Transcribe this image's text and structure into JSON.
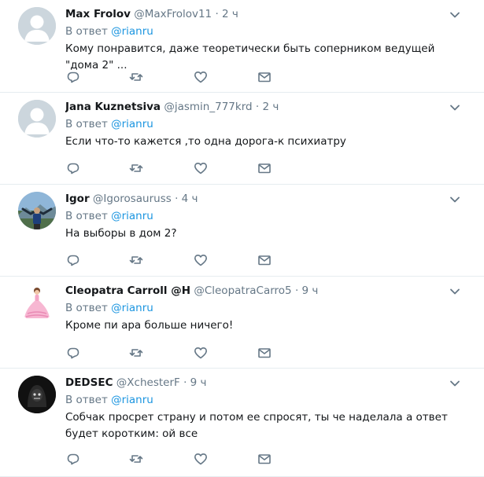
{
  "colors": {
    "accent": "#1b95e0",
    "muted": "#657786",
    "text": "#14171a",
    "divider": "#e6ecf0"
  },
  "tweets": [
    {
      "name": "Max Frolov",
      "handle": "@MaxFrolov11",
      "dot": "·",
      "time": "2 ч",
      "reply_prefix": "В ответ",
      "reply_to": "@rianru",
      "text": "Кому понравится, даже теоретически быть соперником ведущей \"дома 2\" ...",
      "avatar": "default-avatar"
    },
    {
      "name": "Jana Kuznetsiva",
      "handle": "@jasmin_777krd",
      "dot": "·",
      "time": "2 ч",
      "reply_prefix": "В ответ",
      "reply_to": "@rianru",
      "text": "Если что-то кажется ,то одна дорога-к психиатру",
      "avatar": "default-avatar"
    },
    {
      "name": "Igor",
      "handle": "@Igorosauruss",
      "dot": "·",
      "time": "4 ч",
      "reply_prefix": "В ответ",
      "reply_to": "@rianru",
      "text": "На выборы в дом 2?",
      "avatar": "photo-avatar-mountain"
    },
    {
      "name": "Cleopatra Carroll @H",
      "handle": "@CleopatraCarro5",
      "dot": "·",
      "time": "9 ч",
      "reply_prefix": "В ответ",
      "reply_to": "@rianru",
      "text": "Кроме пи ара больше ничего!",
      "avatar": "photo-avatar-pink-dress"
    },
    {
      "name": "DEDSEC",
      "handle": "@XchesterF",
      "dot": "·",
      "time": "9 ч",
      "reply_prefix": "В ответ",
      "reply_to": "@rianru",
      "text": "Собчак просрет страну и потом ее спросят, ты че наделала а ответ будет коротким: ой все",
      "avatar": "photo-avatar-dark-mask"
    }
  ]
}
